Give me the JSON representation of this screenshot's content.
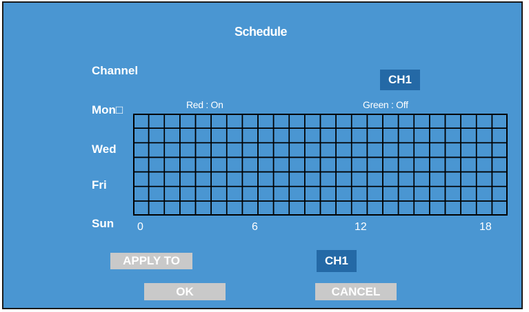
{
  "dialog": {
    "title": "Schedule",
    "channel_label": "Channel",
    "channel_value": "CH1",
    "legend_on": "Red : On",
    "legend_off": "Green : Off",
    "day_labels": [
      "Mon□",
      "Wed",
      "Fri",
      "Sun"
    ],
    "hour_ticks": [
      "0",
      "6",
      "12",
      "18"
    ],
    "apply_to_label": "APPLY TO",
    "apply_to_value": "CH1",
    "ok_label": "OK",
    "cancel_label": "CANCEL"
  },
  "grid": {
    "rows": 7,
    "columns": 24,
    "on_cells": [],
    "colors": {
      "on": "#ff0000",
      "off": "#00c000",
      "line": "#000000"
    }
  },
  "colors": {
    "background": "#4a96d2",
    "accent_button": "#2469a6",
    "gray_button": "#c9c9c9",
    "text": "#ffffff"
  }
}
